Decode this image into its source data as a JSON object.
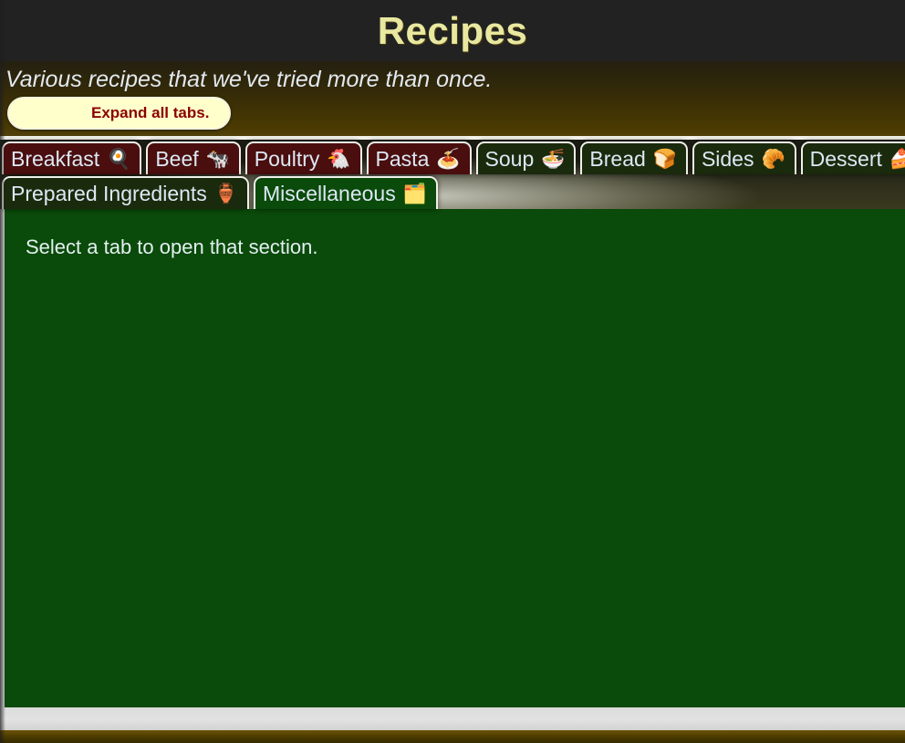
{
  "header": {
    "title": "Recipes"
  },
  "intro": {
    "subtitle": "Various recipes that we've tried more than once.",
    "expand_button_label": "Expand all tabs."
  },
  "tabs": {
    "row1": [
      {
        "label": "Breakfast",
        "emoji": "🍳",
        "emoji_name": "fried-egg-icon",
        "style": "meat",
        "selected": false
      },
      {
        "label": "Beef",
        "emoji": "🐄",
        "emoji_name": "cow-icon",
        "style": "meat",
        "selected": false
      },
      {
        "label": "Poultry",
        "emoji": "🐔",
        "emoji_name": "chicken-icon",
        "style": "meat",
        "selected": false
      },
      {
        "label": "Pasta",
        "emoji": "🍝",
        "emoji_name": "spaghetti-icon",
        "style": "meat",
        "selected": false
      },
      {
        "label": "Soup",
        "emoji": "🍜",
        "emoji_name": "steaming-bowl-icon",
        "style": "veg",
        "selected": false
      },
      {
        "label": "Bread",
        "emoji": "🍞",
        "emoji_name": "bread-icon",
        "style": "veg",
        "selected": false
      },
      {
        "label": "Sides",
        "emoji": "🥐",
        "emoji_name": "croissant-icon",
        "style": "veg",
        "selected": false
      },
      {
        "label": "Dessert",
        "emoji": "🍰",
        "emoji_name": "shortcake-icon",
        "style": "veg",
        "selected": false
      }
    ],
    "row2": [
      {
        "label": "Prepared Ingredients",
        "emoji": "🏺",
        "emoji_name": "amphora-icon",
        "style": "veg",
        "selected": false
      },
      {
        "label": "Miscellaneous",
        "emoji": "🗂️",
        "emoji_name": "card-index-dividers-icon",
        "style": "active",
        "selected": true
      }
    ]
  },
  "content": {
    "message": "Select a tab to open that section."
  },
  "colors": {
    "page_background": "#222222",
    "title_text": "#e8e8a0",
    "subtitle_band_top": "#242010",
    "subtitle_band_bottom": "#4a3a02",
    "button_background": "#ffffcc",
    "button_text": "#8b0000",
    "tab_meat_background": "#4a0e0e",
    "tab_veg_background": "#1a2a0c",
    "tab_active_background": "#0a4a0a",
    "tab_border": "#f0f0ea",
    "tab_text": "#dde8f5",
    "content_background": "#0a4a0a",
    "content_text": "#e3eff0",
    "footer_light": "#dcdcdc",
    "footer_dark": "#4a3a00"
  }
}
